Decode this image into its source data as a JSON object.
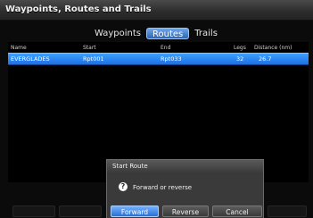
{
  "window": {
    "title": "Waypoints, Routes and Trails"
  },
  "tabs": [
    {
      "label": "Waypoints",
      "active": false
    },
    {
      "label": "Routes",
      "active": true
    },
    {
      "label": "Trails",
      "active": false
    }
  ],
  "table": {
    "columns": [
      "Name",
      "Start",
      "End",
      "Legs",
      "Distance (nm)"
    ],
    "rows": [
      {
        "name": "EVERGLADES",
        "start": "Rpt001",
        "end": "Rpt033",
        "legs": "32",
        "distance": "26.7",
        "selected": true
      }
    ]
  },
  "dialog": {
    "title": "Start Route",
    "icon": "question-icon",
    "message": "Forward or reverse",
    "buttons": [
      "Forward",
      "Reverse",
      "Cancel"
    ]
  },
  "colors": {
    "selection": "#1f6fe3",
    "primary_button": "#2a6fd6"
  }
}
